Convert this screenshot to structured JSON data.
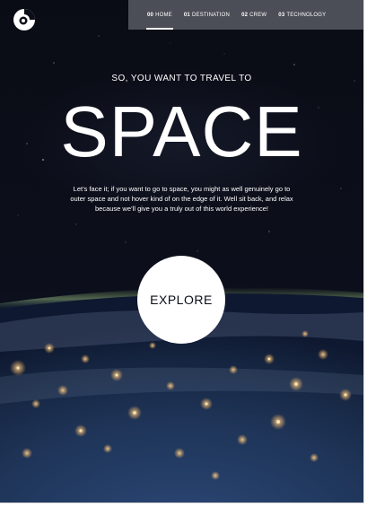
{
  "brand": {
    "logo_icon": "space-tourism-logo-icon"
  },
  "nav": {
    "items": [
      {
        "num": "00",
        "label": "HOME",
        "active": true
      },
      {
        "num": "01",
        "label": "DESTINATION",
        "active": false
      },
      {
        "num": "02",
        "label": "CREW",
        "active": false
      },
      {
        "num": "03",
        "label": "TECHNOLOGY",
        "active": false
      }
    ]
  },
  "hero": {
    "subtitle": "SO, YOU WANT TO TRAVEL TO",
    "title": "SPACE",
    "body": "Let’s face it; if you want to go to space, you might as well genuinely go to outer space and not hover kind of on the edge of it. Well sit back, and relax because we’ll give you a truly out of this world experience!",
    "cta_label": "EXPLORE"
  },
  "colors": {
    "background": "#0b0d17",
    "text": "#ffffff",
    "nav_bg": "#82858e",
    "cta_bg": "#ffffff",
    "cta_text": "#0b0d17"
  }
}
